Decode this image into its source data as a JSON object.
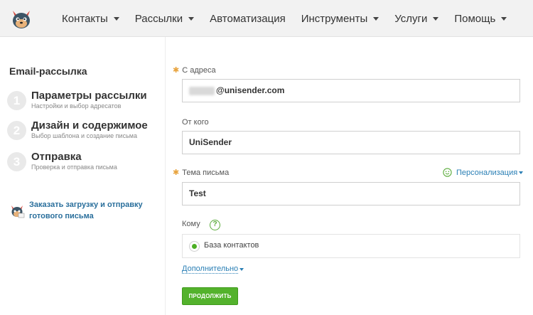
{
  "nav": {
    "items": [
      {
        "label": "Контакты",
        "has_dropdown": true
      },
      {
        "label": "Рассылки",
        "has_dropdown": true
      },
      {
        "label": "Автоматизация",
        "has_dropdown": false
      },
      {
        "label": "Инструменты",
        "has_dropdown": true
      },
      {
        "label": "Услуги",
        "has_dropdown": true
      },
      {
        "label": "Помощь",
        "has_dropdown": true
      }
    ]
  },
  "sidebar": {
    "title": "Email-рассылка",
    "steps": [
      {
        "number": "1",
        "title": "Параметры рассылки",
        "subtitle": "Настройки и выбор адресатов"
      },
      {
        "number": "2",
        "title": "Дизайн и содержимое",
        "subtitle": "Выбор шаблона и создание письма"
      },
      {
        "number": "3",
        "title": "Отправка",
        "subtitle": "Проверка и отправка письма"
      }
    ],
    "order_link": "Заказать загрузку и отправку готового письма"
  },
  "form": {
    "from_address_label": "С адреса",
    "from_address_value": "@unisender.com",
    "from_name_label": "От кого",
    "from_name_value": "UniSender",
    "subject_label": "Тема письма",
    "personalization_label": "Персонализация",
    "subject_value": "Test",
    "to_label": "Кому",
    "help_glyph": "?",
    "to_option": "База контактов",
    "more_label": "Дополнительно",
    "continue_label": "ПРОДОЛЖИТЬ",
    "required_marker": "✱"
  },
  "colors": {
    "accent_green": "#53b22c",
    "link_blue": "#2a7fb5",
    "required_orange": "#e8a33d",
    "topbar_bg": "#f2f2f2"
  },
  "icons": [
    "logo-mascot-icon",
    "chevron-down-icon",
    "mascot-small-icon",
    "smiley-icon",
    "help-icon",
    "radio-selected-icon"
  ]
}
